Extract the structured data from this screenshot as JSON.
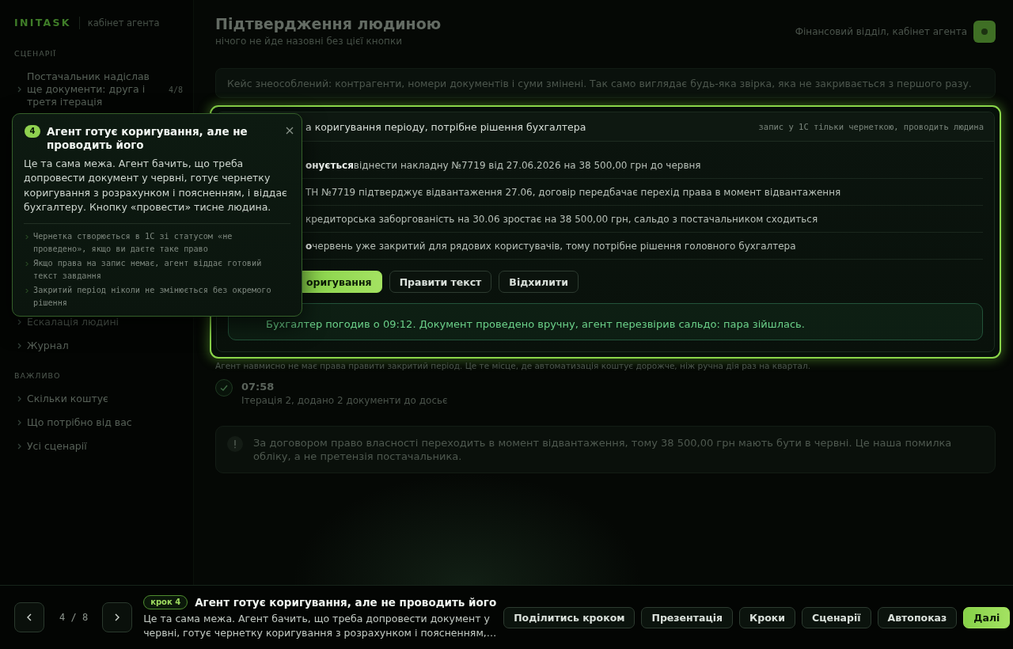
{
  "sidebar": {
    "logo": "INITASK",
    "subtitle": "кабінет агента",
    "groups": [
      {
        "heading": "СЦЕНАРІЇ",
        "items": [
          {
            "label": "Постачальник надіслав ще документи: друга і третя ітерація",
            "count": "4/8"
          }
        ]
      },
      {
        "items": [
          {
            "label": "Ескалація людині"
          },
          {
            "label": "Журнал"
          }
        ]
      },
      {
        "heading": "ВАЖЛИВО",
        "items": [
          {
            "label": "Скільки коштує"
          },
          {
            "label": "Що потрібно від вас"
          },
          {
            "label": "Усі сценарії"
          }
        ]
      }
    ]
  },
  "header": {
    "title": "Підтвердження людиною",
    "subtitle": "нічого не йде назовні без цієї кнопки",
    "account": "Фінансовий відділ, кабінет агента"
  },
  "banner": "Кейс знеособлений: контрагенти, номери документів і суми змінені. Так само виглядає будь-яка звірка, яка не закривається з першого разу.",
  "approval_card": {
    "title": "а коригування періоду, потрібне рішення бухгалтера",
    "note": "запис у 1С тільки чернеткою, проводить людина",
    "rows": [
      {
        "label": "онується",
        "text": "віднести накладну №7719 від 27.06.2026 на 38 500,00 грн до червня"
      },
      {
        "text": "ТН №7719 підтверджує відвантаження 27.06, договір передбачає перехід права в момент відвантаження"
      },
      {
        "text": "кредиторська заборгованість на 30.06 зростає на 38 500,00 грн, сальдо з постачальником сходиться"
      },
      {
        "label": "о",
        "text": "червень уже закритий для рядових користувачів, тому потрібне рішення головного бухгалтера"
      }
    ],
    "actions": [
      {
        "label": "оригування",
        "kind": "primary"
      },
      {
        "label": "Правити текст",
        "kind": "secondary"
      },
      {
        "label": "Відхилити",
        "kind": "secondary"
      }
    ],
    "result": "Бухгалтер погодив о 09:12. Документ проведено вручну, агент перезвірив сальдо: пара зійшлась."
  },
  "caption": "Агент навмисно не має права правити закритий період. Це те місце, де автоматизація коштує дорожче, ніж ручна дія раз на квартал.",
  "timeline": [
    {
      "time": "07:58",
      "text": "Ітерація 2, додано 2 документи до досьє"
    }
  ],
  "notice": "За договором право власності переходить в момент відвантаження, тому 38 500,00 грн мають бути в червні. Це наша помилка обліку, а не претензія постачальника.",
  "tour_popup": {
    "step": "4",
    "title": "Агент готує коригування, але не проводить його",
    "body": "Це та сама межа. Агент бачить, що треба допровести документ у червні, готує чернетку коригування з розрахунком і поясненням, і віддає бухгалтеру. Кнопку «провести» тисне людина.",
    "points": [
      "Чернетка створюється в 1С зі статусом «не проведено», якщо ви даєте таке право",
      "Якщо права на запис немає, агент віддає готовий текст завдання",
      "Закритий період ніколи не змінюється без окремого рішення"
    ]
  },
  "tour_bar": {
    "position": "4 / 8",
    "step_label": "крок 4",
    "title": "Агент готує коригування, але не проводить його",
    "description": "Це та сама межа. Агент бачить, що треба допровести документ у червні, готує чернетку коригування з розрахунком і поясненням,…",
    "buttons": [
      {
        "label": "Поділитись кроком",
        "kind": "secondary"
      },
      {
        "label": "Презентація",
        "kind": "secondary"
      },
      {
        "label": "Кроки",
        "kind": "secondary"
      },
      {
        "label": "Сценарії",
        "kind": "secondary"
      },
      {
        "label": "Автопоказ",
        "kind": "secondary"
      },
      {
        "label": "Далі",
        "kind": "primary"
      }
    ]
  }
}
